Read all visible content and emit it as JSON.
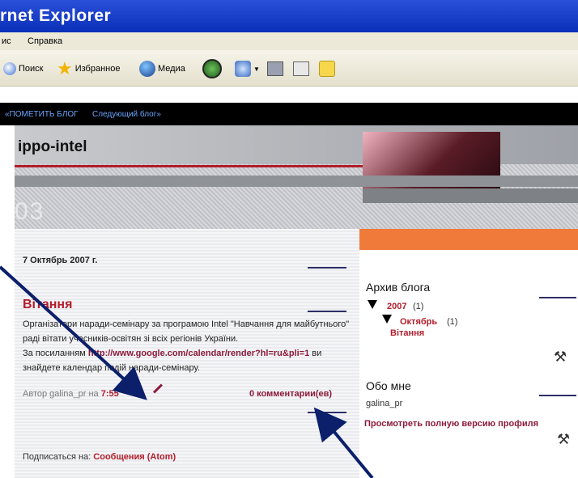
{
  "window": {
    "title": "rnet Explorer"
  },
  "menu": {
    "items": [
      "ис",
      "Справка"
    ]
  },
  "toolbar": {
    "search": "Поиск",
    "favorites": "Избранное",
    "media": "Медиа"
  },
  "navbar": {
    "links": [
      "«ПОМЕТИТЬ БЛОГ",
      "Следующий блог»"
    ]
  },
  "blog": {
    "title": "ippo-intel",
    "header_num": "03"
  },
  "post": {
    "date": "7 Октябрь 2007 г.",
    "title": "Вітання",
    "text1": "Організатори наради-семінару за програмою Intel \"Навчання для майбутнього\" раді вітати учасників-освітян зі всіх регіонів України.",
    "text2": "За посиланням",
    "link": "http://www.google.com/calendar/render?hl=ru&pli=1",
    "text3": "ви знайдете календар подій наради-семінару.",
    "author_prefix": "Автор galina_pr на",
    "time": "7:55",
    "comments": "0 комментарии(ев)",
    "subscribe_label": "Подписаться на:",
    "subscribe_link": "Сообщения (Atom)"
  },
  "sidebar": {
    "archive_title": "Архив блога",
    "year": "2007",
    "year_count": "(1)",
    "month": "Октябрь",
    "month_count": "(1)",
    "post_link": "Вітання",
    "about_title": "Обо мне",
    "user": "galina_pr",
    "profile_link": "Просмотреть полную версию профиля"
  },
  "colors": {
    "accent": "#b21d2b",
    "orange": "#f07a3a",
    "link": "#8d1a3a"
  }
}
